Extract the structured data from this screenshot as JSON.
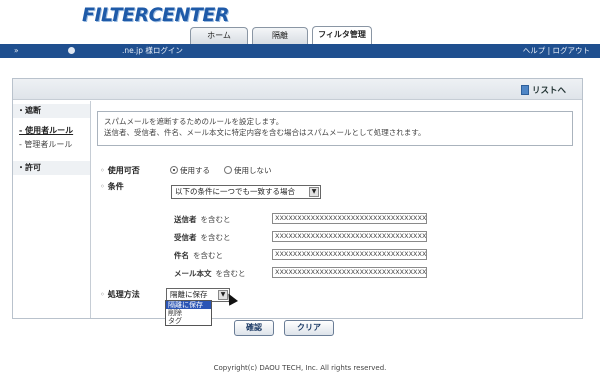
{
  "header": {
    "logo": "FILTERCENTER",
    "tabs": [
      {
        "label": "ホーム",
        "active": false
      },
      {
        "label": "隔離",
        "active": false
      },
      {
        "label": "フィルタ管理",
        "active": true
      }
    ]
  },
  "topbar": {
    "arrow": "»",
    "domain_login": ".ne.jp 様ログイン",
    "links": "ヘルプ | ログアウト"
  },
  "panel": {
    "list_link": "リストへ"
  },
  "sidebar": {
    "sections": [
      {
        "label": "・遮断"
      },
      {
        "label": "・許可"
      }
    ],
    "items": [
      {
        "label": "- 使用者ルール",
        "active": true
      },
      {
        "label": "- 管理者ルール",
        "active": false
      }
    ]
  },
  "description": {
    "line1": "スパムメールを遮断するためのルールを設定します。",
    "line2": "送信者、受信者、件名、メール本文に特定内容を含む場合はスパムメールとして処理されます。"
  },
  "form": {
    "usage_label": "使用可否",
    "usage_on": "使用する",
    "usage_off": "使用しない",
    "condition_label": "条件",
    "condition_select": "以下の条件に一つでも一致する場合",
    "fields": [
      {
        "name": "送信者",
        "suffix": "を含むと",
        "value": "XXXXXXXXXXXXXXXXXXXXXXXXXXXXXXXXXX"
      },
      {
        "name": "受信者",
        "suffix": "を含むと",
        "value": "XXXXXXXXXXXXXXXXXXXXXXXXXXXXXXXXXX"
      },
      {
        "name": "件名",
        "suffix": "を含むと",
        "value": "XXXXXXXXXXXXXXXXXXXXXXXXXXXXXXXXXX"
      },
      {
        "name": "メール本文",
        "suffix": "を含むと",
        "value": "XXXXXXXXXXXXXXXXXXXXXXXXXXXXXXXXXX"
      }
    ],
    "action_label": "処理方法",
    "action_select": "隔離に保存",
    "action_options": [
      "隔離に保存",
      "削除",
      "タグ"
    ]
  },
  "buttons": {
    "confirm": "確認",
    "clear": "クリア"
  },
  "footer": {
    "copyright": "Copyright(c) DAOU TECH, Inc. All rights reserved."
  },
  "colors": {
    "topbar": "#1f4f8f",
    "logo": "#1e5aa8",
    "selection": "#2b55b5"
  }
}
